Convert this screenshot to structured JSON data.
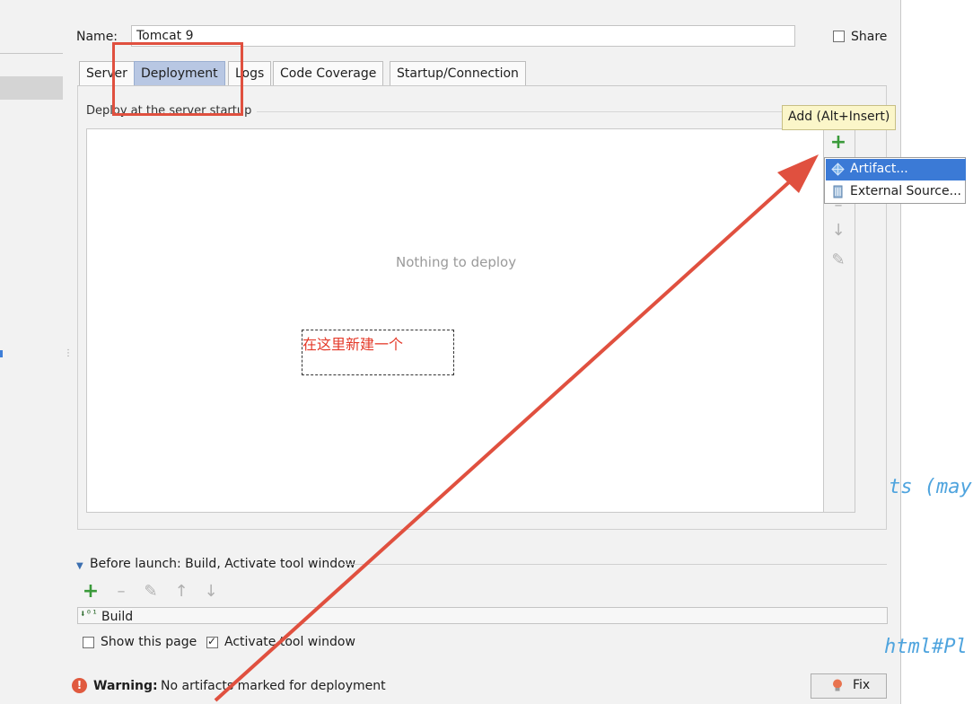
{
  "name_row": {
    "label": "Name:",
    "value": "Tomcat 9",
    "share_label": "Share",
    "share_checked": false
  },
  "tabs": [
    {
      "label": "Server",
      "active": false
    },
    {
      "label": "Deployment",
      "active": true
    },
    {
      "label": "Logs",
      "active": false
    },
    {
      "label": "Code Coverage",
      "active": false
    },
    {
      "label": "Startup/Connection",
      "active": false
    }
  ],
  "deployment": {
    "group_title": "Deploy at the server startup",
    "empty_text": "Nothing to deploy",
    "tooltip": "Add (Alt+Insert)",
    "add_icon": "plus-icon",
    "popup_items": [
      {
        "label": "Artifact...",
        "icon": "artifact-icon",
        "selected": true
      },
      {
        "label": "External Source...",
        "icon": "external-source-icon",
        "selected": false
      }
    ]
  },
  "annotation": {
    "text": "在这里新建一个",
    "color": "#e0503f"
  },
  "before_launch": {
    "label": "Before launch: Build, Activate tool window",
    "item_label": "Build",
    "show_page_label": "Show this page",
    "show_page_checked": false,
    "activate_label": "Activate tool window",
    "activate_checked": true
  },
  "footer": {
    "warning_prefix": "Warning:",
    "warning_message": "No artifacts marked for deployment",
    "fix_label": "Fix"
  },
  "background_code": {
    "fragment_1": "ts (may",
    "fragment_2": "html#Pl"
  },
  "colors": {
    "accent": "#3b7ad6",
    "active_tab": "#b8c7e3",
    "tooltip_bg": "#fbf6c9",
    "warning": "#e05a3f",
    "add_green": "#3a9a3a"
  }
}
